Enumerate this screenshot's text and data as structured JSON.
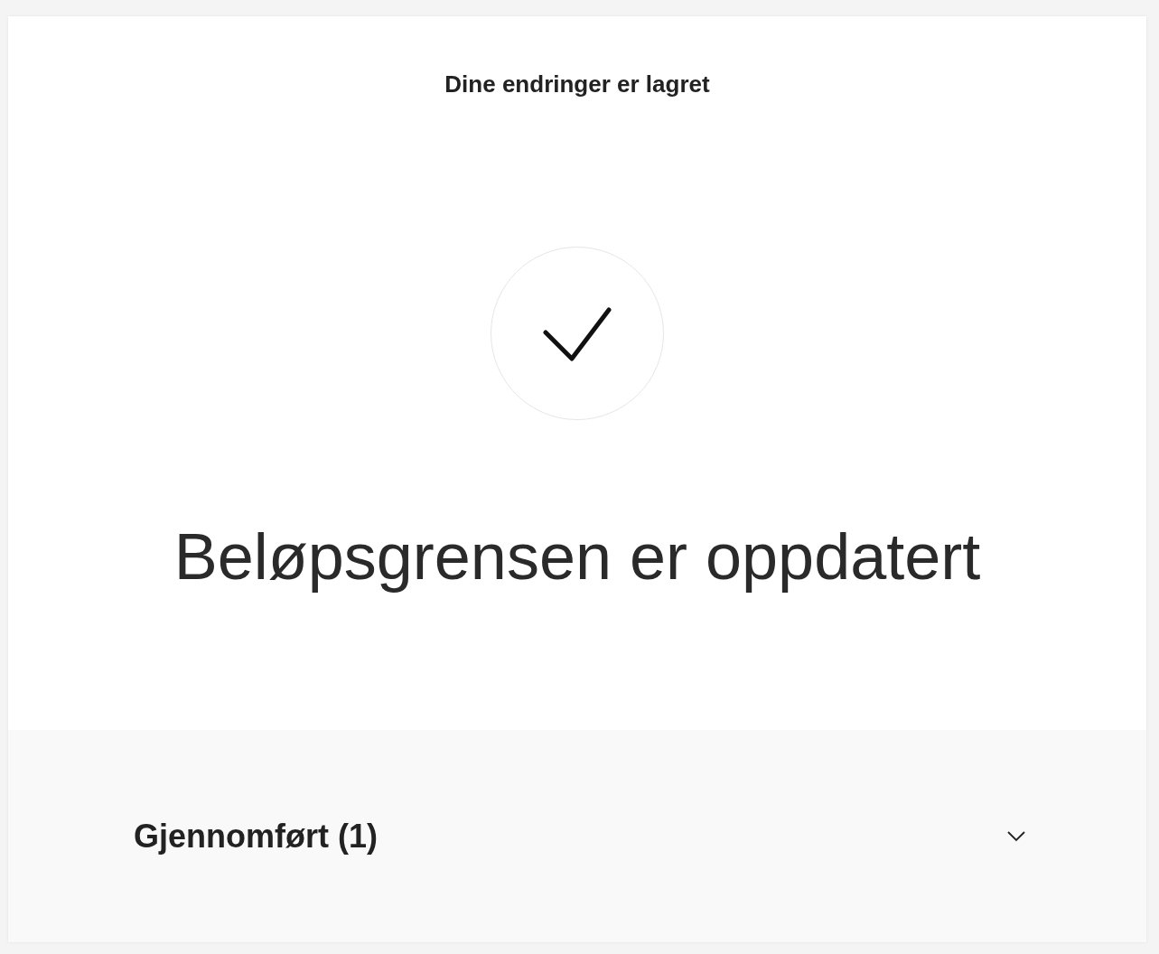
{
  "header": {
    "title": "Dine endringer er lagret"
  },
  "confirmation": {
    "heading": "Beløpsgrensen er oppdatert"
  },
  "accordion": {
    "label": "Gjennomført (1)",
    "expanded": false
  }
}
